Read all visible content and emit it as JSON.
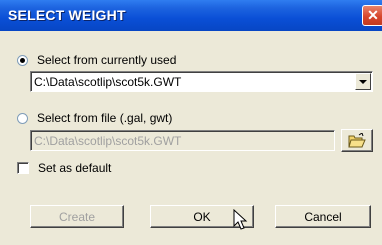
{
  "window": {
    "title": "SELECT WEIGHT",
    "close_icon": "close-icon"
  },
  "option_current": {
    "label": "Select from currently used",
    "selected": true,
    "combo_value": "C:\\Data\\scotlip\\scot5k.GWT"
  },
  "option_file": {
    "label": "Select from file (.gal, gwt)",
    "selected": false,
    "path_value": "C:\\Data\\scotlip\\scot5k.GWT",
    "browse_icon": "folder-open-icon"
  },
  "set_default": {
    "label": "Set as default",
    "checked": false
  },
  "buttons": {
    "create": "Create",
    "ok": "OK",
    "cancel": "Cancel"
  }
}
